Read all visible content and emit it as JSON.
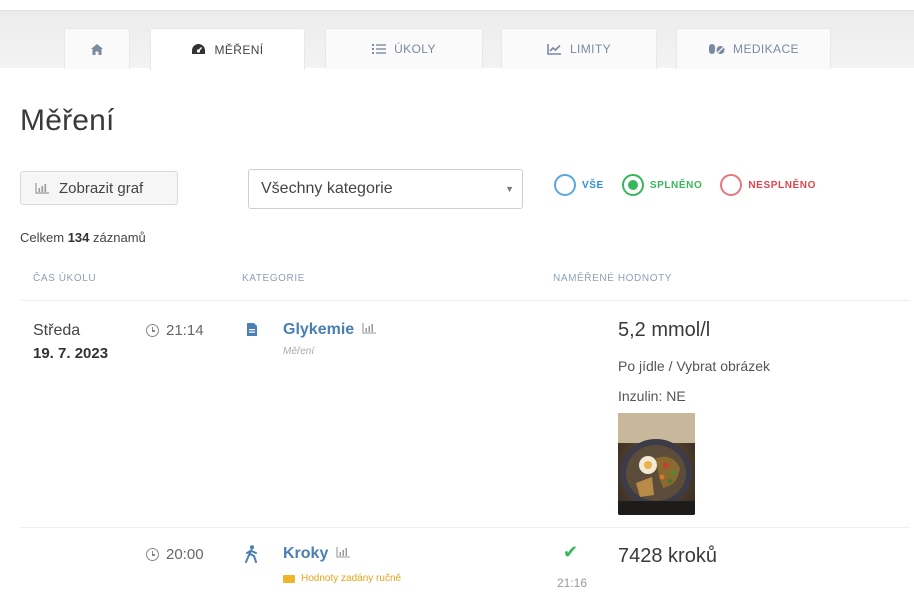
{
  "tabs": [
    {
      "label": "",
      "icon": "home-icon",
      "active": false
    },
    {
      "label": "MĚŘENÍ",
      "icon": "gauge-icon",
      "active": true
    },
    {
      "label": "ÚKOLY",
      "icon": "task-list-icon",
      "active": false
    },
    {
      "label": "LIMITY",
      "icon": "line-chart-icon",
      "active": false
    },
    {
      "label": "MEDIKACE",
      "icon": "pills-icon",
      "active": false
    }
  ],
  "page_title": "Měření",
  "toolbar": {
    "graph_button": "Zobrazit graf",
    "category_select": "Všechny kategorie",
    "filters": [
      {
        "label": "VŠE",
        "color": "#2e8fd8",
        "checked": false
      },
      {
        "label": "SPLNĚNO",
        "color": "#36b85a",
        "checked": true
      },
      {
        "label": "NESPLNĚNO",
        "color": "#e0444c",
        "checked": false
      }
    ]
  },
  "summary": {
    "prefix": "Celkem",
    "count": "134",
    "suffix": "záznamů"
  },
  "columns": {
    "task_time": "ČAS ÚKOLU",
    "category": "KATEGORIE",
    "measured_values": "NAMĚŘENÉ HODNOTY"
  },
  "rows": [
    {
      "day": "Středa",
      "date": "19. 7. 2023",
      "time": "21:14",
      "category": "Glykemie",
      "category_icon": "document-icon",
      "subtitle": "Měření",
      "value": "5,2 mmol/l",
      "note": "Po jídle / Vybrat obrázek",
      "insulin": "Inzulin: NE",
      "has_photo": true
    },
    {
      "day": "",
      "date": "",
      "time": "20:00",
      "category": "Kroky",
      "category_icon": "walking-icon",
      "manual_note": "Hodnoty zadány ručně",
      "value": "7428 kroků",
      "done_time": "21:16",
      "status": "check-icon"
    }
  ],
  "colors": {
    "accent": "#4a7fb5",
    "success": "#36b85a",
    "danger": "#e0444c",
    "info": "#2e8fd8",
    "warning": "#e3a41b"
  }
}
